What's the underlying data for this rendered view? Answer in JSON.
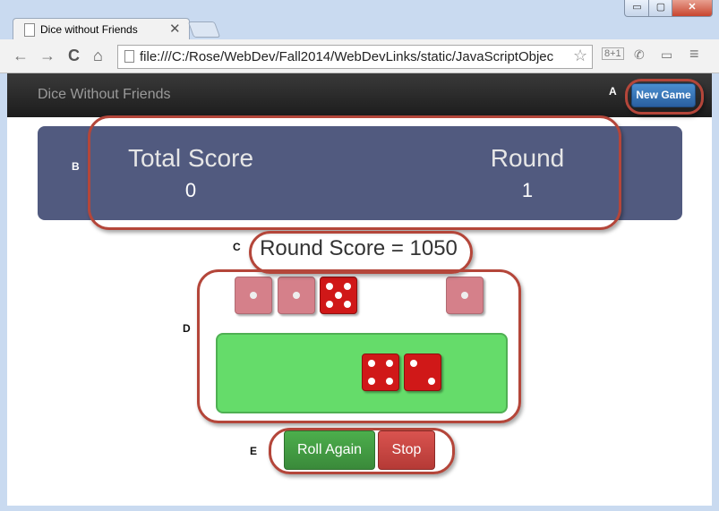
{
  "browser": {
    "tab_title": "Dice without Friends",
    "tab_close": "✕",
    "url": "file:///C:/Rose/WebDev/Fall2014/WebDevLinks/static/JavaScriptObjec",
    "window_controls": {
      "minimize": "▭",
      "maximize": "▢",
      "close": "✕"
    },
    "nav": {
      "back": "←",
      "forward": "→",
      "reload": "C",
      "home": "⌂"
    },
    "star": "☆",
    "ext_icons": [
      "8+1",
      "✆",
      "▭",
      "≡"
    ]
  },
  "app": {
    "brand": "Dice Without Friends",
    "new_game_label": "New Game",
    "score_panel": {
      "total_score_label": "Total Score",
      "total_score_value": "0",
      "round_label": "Round",
      "round_value": "1"
    },
    "round_score": "Round Score = 1050",
    "held_dice": [
      1,
      1,
      5,
      1
    ],
    "rolled_dice": [
      4,
      2
    ],
    "buttons": {
      "roll_again": "Roll Again",
      "stop": "Stop"
    }
  },
  "annotations": {
    "A": "A",
    "B": "B",
    "C": "C",
    "D": "D",
    "E": "E"
  },
  "colors": {
    "annotation": "#b4463a",
    "score_panel": "#515a7f",
    "tray": "#65dc6a"
  }
}
